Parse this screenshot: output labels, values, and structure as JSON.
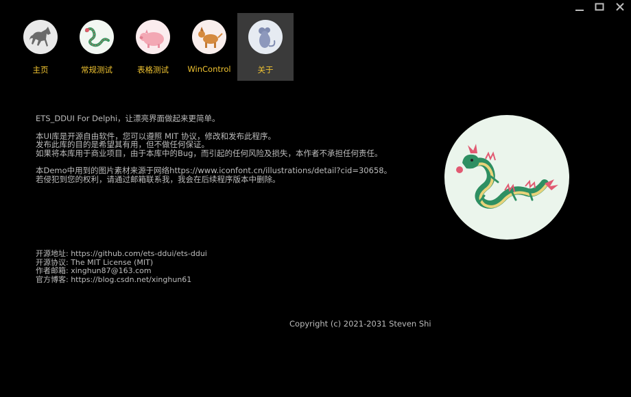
{
  "window": {
    "controls": {
      "minimize_icon": "minimize-icon",
      "maximize_icon": "maximize-icon",
      "close_icon": "close-icon"
    }
  },
  "nav": {
    "items": [
      {
        "label": "主页",
        "icon": "horse-icon",
        "active": false
      },
      {
        "label": "常规测试",
        "icon": "dragon-icon",
        "active": false
      },
      {
        "label": "表格测试",
        "icon": "pig-icon",
        "active": false
      },
      {
        "label": "WinControl",
        "icon": "dog-icon",
        "active": false
      },
      {
        "label": "关于",
        "icon": "rat-icon",
        "active": true
      }
    ],
    "label_color": "#f2c531",
    "active_bg": "#3a3a3a"
  },
  "about": {
    "line1": "ETS_DDUI For Delphi，让漂亮界面做起来更简单。",
    "line2": "本UI库是开源自由软件，您可以遵照 MIT 协议，修改和发布此程序。",
    "line3": "发布此库的目的是希望其有用，但不做任何保证。",
    "line4": "如果将本库用于商业项目，由于本库中的Bug，而引起的任何风险及损失，本作者不承担任何责任。",
    "line5": "本Demo中用到的图片素材来源于网络https://www.iconfont.cn/illustrations/detail?cid=30658。",
    "line6": "若侵犯到您的权利，请通过邮箱联系我，我会在后续程序版本中删除。"
  },
  "links": {
    "source": "开源地址: https://github.com/ets-ddui/ets-ddui",
    "license": "开源协议: The MIT License (MIT)",
    "email": "作者邮箱: xinghun87@163.com",
    "blog": "官方博客: https://blog.csdn.net/xinghun61"
  },
  "copyright": "Copyright (c) 2021-2031 Steven Shi",
  "hero": {
    "icon": "dragon-illustration",
    "bg": "#ebf5ec"
  }
}
